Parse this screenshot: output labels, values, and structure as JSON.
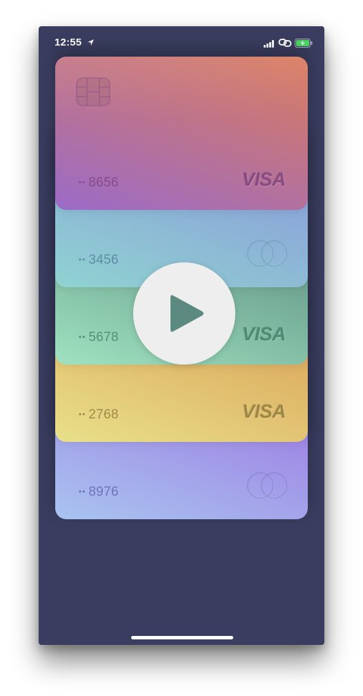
{
  "status_bar": {
    "time": "12:55",
    "icons": [
      "location-arrow-icon",
      "signal-icon",
      "link-icon",
      "battery-charging-icon"
    ]
  },
  "cards": [
    {
      "number_prefix": "••",
      "last4": "8656",
      "network": "VISA",
      "icon": "visa-logo",
      "has_chip": true,
      "colors": [
        "#9b6bc8",
        "#d97a5c"
      ],
      "text_color": "#7a3f7a"
    },
    {
      "number_prefix": "••",
      "last4": "3456",
      "network": "Mastercard",
      "icon": "mastercard-logo-icon",
      "has_chip": false,
      "colors": [
        "#8fd3d1",
        "#8a93db"
      ],
      "text_color": "#4c7a93"
    },
    {
      "number_prefix": "••",
      "last4": "5678",
      "network": "VISA",
      "icon": "visa-logo",
      "has_chip": false,
      "colors": [
        "#9fe2c0",
        "#5a8a7e"
      ],
      "text_color": "#3f7a64"
    },
    {
      "number_prefix": "••",
      "last4": "2768",
      "network": "VISA",
      "icon": "visa-logo",
      "has_chip": false,
      "colors": [
        "#e8e08a",
        "#d99a52"
      ],
      "text_color": "#8a7434"
    },
    {
      "number_prefix": "••",
      "last4": "8976",
      "network": "Mastercard",
      "icon": "mastercard-logo-icon",
      "has_chip": false,
      "colors": [
        "#a9c4f0",
        "#9b6fe0"
      ],
      "text_color": "#5d5cab"
    }
  ],
  "play_button": {
    "icon": "play-icon"
  },
  "colors": {
    "background": "#3b3d60",
    "play_circle": "#eeeeee",
    "play_triangle": "#5c8a80"
  }
}
